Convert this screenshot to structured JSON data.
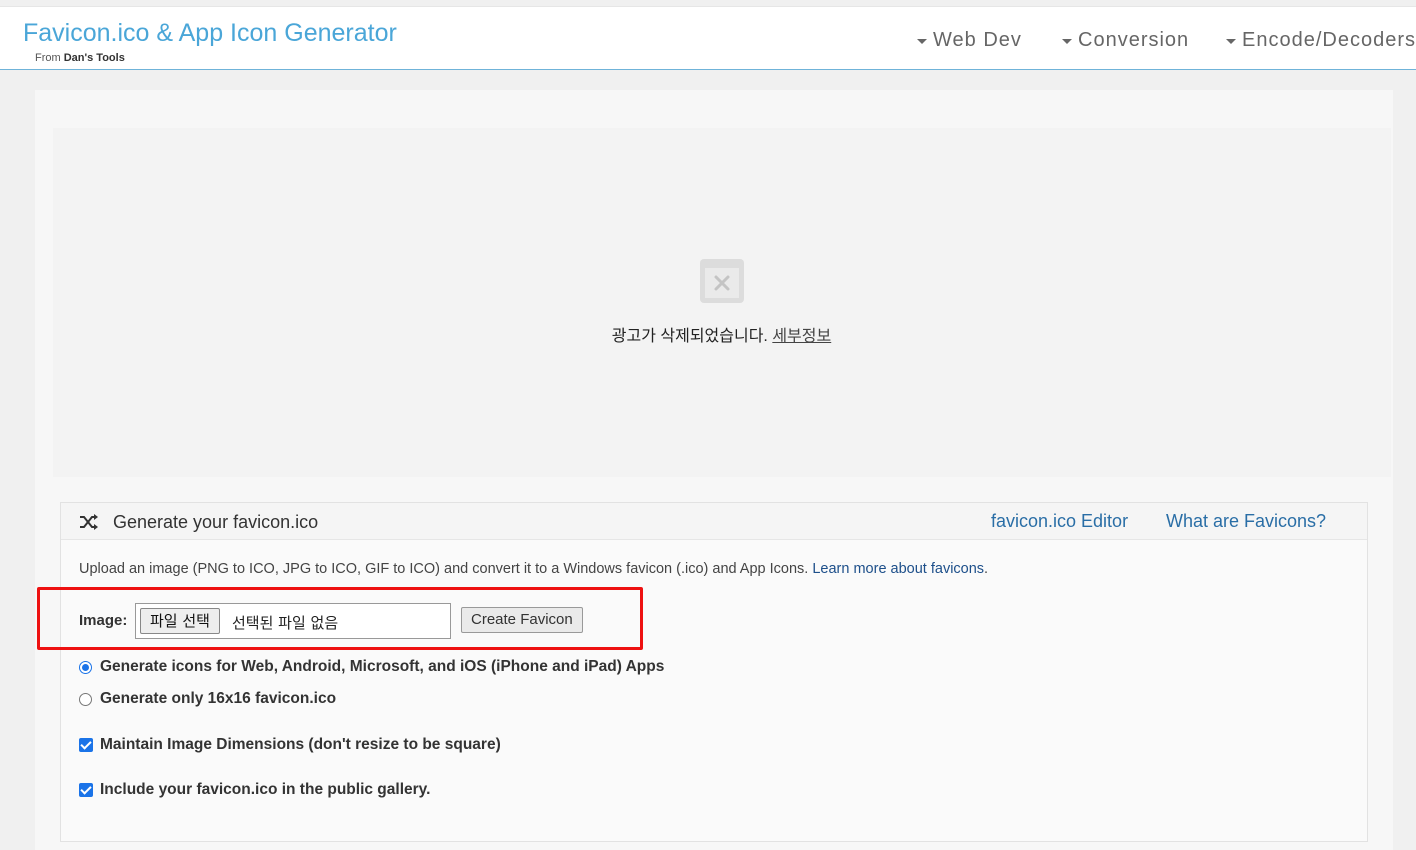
{
  "header": {
    "title": "Favicon.ico & App Icon Generator",
    "from_prefix": "From",
    "from_brand": "Dan's Tools",
    "nav": [
      "Web Dev",
      "Conversion",
      "Encode/Decoders"
    ]
  },
  "ad": {
    "message": "광고가 삭제되었습니다.",
    "details_link": "세부정보"
  },
  "panel": {
    "title": "Generate your favicon.ico",
    "links": [
      "favicon.ico Editor",
      "What are Favicons?"
    ],
    "description": "Upload an image (PNG to ICO, JPG to ICO, GIF to ICO) and convert it to a Windows favicon (.ico) and App Icons.",
    "description_link": "Learn more about favicons",
    "description_end": ".",
    "image_label": "Image:",
    "file_button": "파일 선택",
    "file_status": "선택된 파일 없음",
    "create_button": "Create Favicon",
    "options": {
      "radio_all": "Generate icons for Web, Android, Microsoft, and iOS (iPhone and iPad) Apps",
      "radio_only": "Generate only 16x16 favicon.ico",
      "radio_selected": "radio_all",
      "maintain_dimensions": "Maintain Image Dimensions (don't resize to be square)",
      "maintain_checked": true,
      "public_gallery": "Include your favicon.ico in the public gallery.",
      "public_checked": true
    }
  },
  "colors": {
    "brand": "#4aa6d8",
    "link": "#2a6ea6",
    "highlight": "#ee1111",
    "control_accent": "#1a73e8"
  }
}
